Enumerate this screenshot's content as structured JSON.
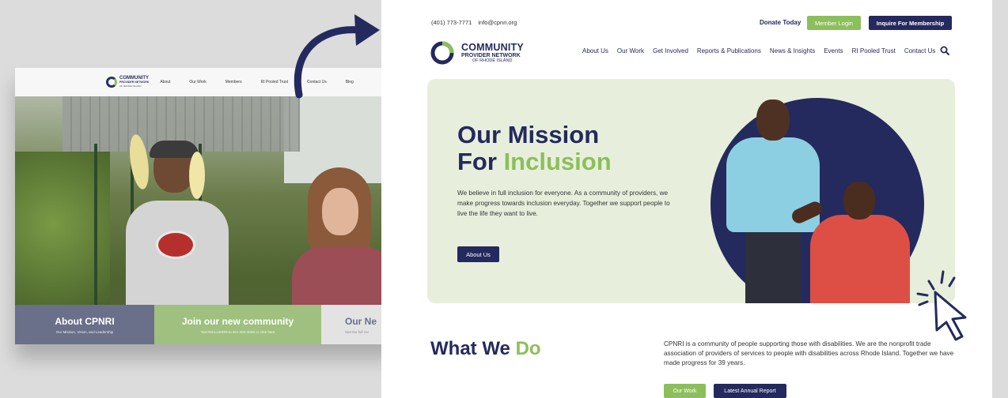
{
  "old_site": {
    "logo": {
      "line1": "COMMUNITY",
      "line2": "PROVIDER NETWORK",
      "line3": "OF RHODE ISLAND"
    },
    "nav": [
      "About",
      "Our Work",
      "Members",
      "RI Pooled Trust",
      "Contact Us",
      "Blog"
    ],
    "cards": [
      {
        "title": "About CPNRI",
        "subtitle": "Our Mission, Vision, and Leadership"
      },
      {
        "title": "Join our new community",
        "subtitle": "Text INCLUSION to 401-200-3025 or click here"
      },
      {
        "title": "Our Ne",
        "subtitle": "See the full rev"
      }
    ]
  },
  "new_site": {
    "topbar": {
      "phone": "(401) 773-7771",
      "email": "info@cpnri.org",
      "donate": "Donate Today",
      "member_login": "Member Login",
      "inquire": "Inquire For Membership"
    },
    "logo": {
      "line1": "COMMUNITY",
      "line2": "PROVIDER NETWORK",
      "line3": "OF RHODE ISLAND"
    },
    "nav": [
      "About Us",
      "Our Work",
      "Get Involved",
      "Reports & Publications",
      "News & Insights",
      "Events",
      "RI Pooled Trust",
      "Contact Us"
    ],
    "hero": {
      "title_line1": "Our Mission",
      "title_line2_a": "For ",
      "title_line2_b": "Inclusion",
      "description": "We believe in full inclusion for everyone. As a community of providers, we make progress towards inclusion everyday. Together we support people to live the life they want to live.",
      "button": "About Us"
    },
    "what_we_do": {
      "title_a": "What We ",
      "title_b": "Do",
      "description": "CPNRI is a community of people supporting those with disabilities. We are the nonprofit trade association of providers of services to people with disabilities across Rhode Island. Together we have made progress for 39 years.",
      "button_work": "Our Work",
      "button_report": "Latest Annual Report"
    }
  },
  "colors": {
    "navy": "#242a5e",
    "green": "#8cbf5b",
    "hero_bg": "#e7efdc",
    "slate": "#6a6f8a"
  },
  "icons": [
    "arrow-icon",
    "search-icon",
    "cursor-click-icon",
    "logo-mark-icon"
  ]
}
